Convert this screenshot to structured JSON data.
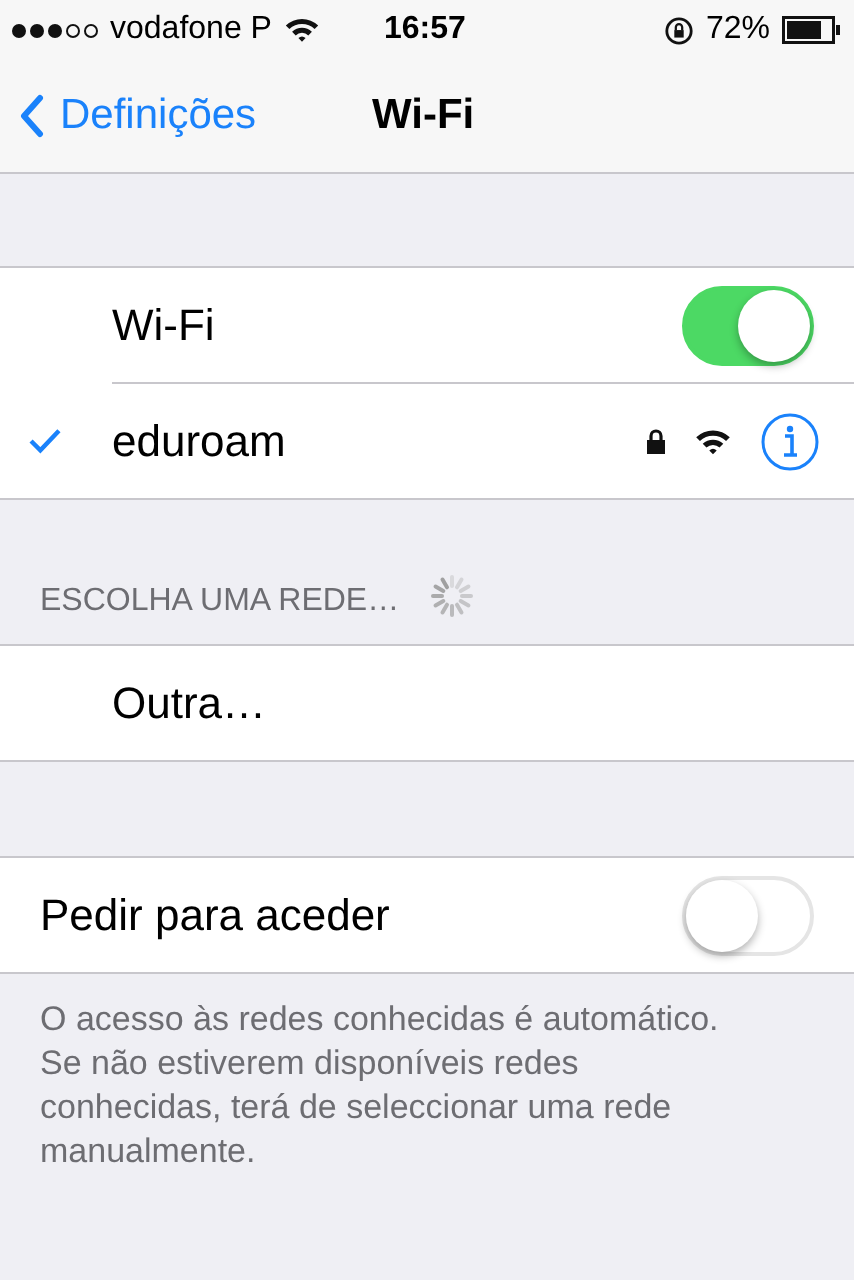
{
  "status_bar": {
    "carrier": "vodafone P",
    "time": "16:57",
    "battery": "72%"
  },
  "nav": {
    "back": "Definições",
    "title": "Wi-Fi"
  },
  "wifi": {
    "label": "Wi-Fi",
    "on": true
  },
  "connected": {
    "name": "eduroam",
    "selected": true,
    "secured": true
  },
  "networks_header": {
    "title": "ESCOLHA UMA REDE…",
    "loading": true
  },
  "other": {
    "label": "Outra…"
  },
  "ask_to_join": {
    "label": "Pedir para aceder",
    "on": false
  },
  "footer": "O acesso às redes conhecidas é automático. Se não estiverem disponíveis redes conhecidas, terá de seleccionar uma rede manualmente."
}
